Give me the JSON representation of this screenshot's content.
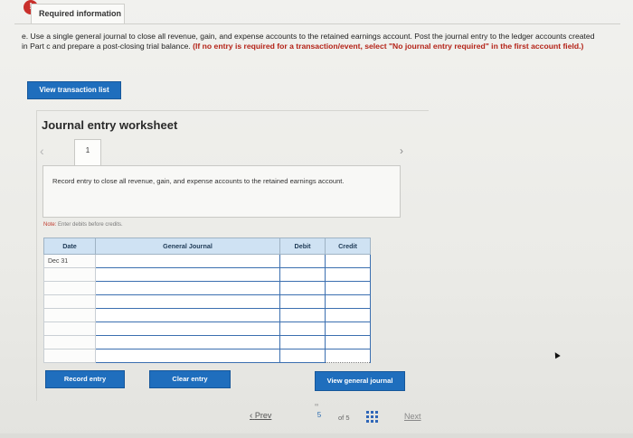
{
  "header": {
    "badge": "!",
    "tab_label": "Required information"
  },
  "instruction": {
    "text": "e. Use a single general journal to close all revenue, gain, and expense accounts to the retained earnings account. Post the journal entry to the ledger accounts created in Part c and prepare a post-closing trial balance. ",
    "bold": "(If no entry is required for a transaction/event, select \"No journal entry required\" in the first account field.)"
  },
  "view_transaction_label": "View transaction list",
  "worksheet": {
    "title": "Journal entry worksheet",
    "tab_number": "1",
    "entry_description": "Record entry to close all revenue, gain, and expense accounts to the retained earnings account.",
    "note_label": "Note:",
    "note_text": " Enter debits before credits."
  },
  "table": {
    "headers": {
      "date": "Date",
      "account": "General Journal",
      "debit": "Debit",
      "credit": "Credit"
    },
    "rows": [
      {
        "date": "Dec 31"
      },
      {
        "date": ""
      },
      {
        "date": ""
      },
      {
        "date": ""
      },
      {
        "date": ""
      },
      {
        "date": ""
      },
      {
        "date": ""
      },
      {
        "date": ""
      }
    ]
  },
  "buttons": {
    "record": "Record entry",
    "clear": "Clear entry",
    "view_general": "View general journal"
  },
  "pager": {
    "prev": "Prev",
    "current": "5",
    "of_total": "of 5",
    "next": "Next"
  },
  "colors": {
    "accent_blue": "#1f6ebd",
    "header_blue": "#cfe2f3",
    "alert_red": "#b42318"
  }
}
